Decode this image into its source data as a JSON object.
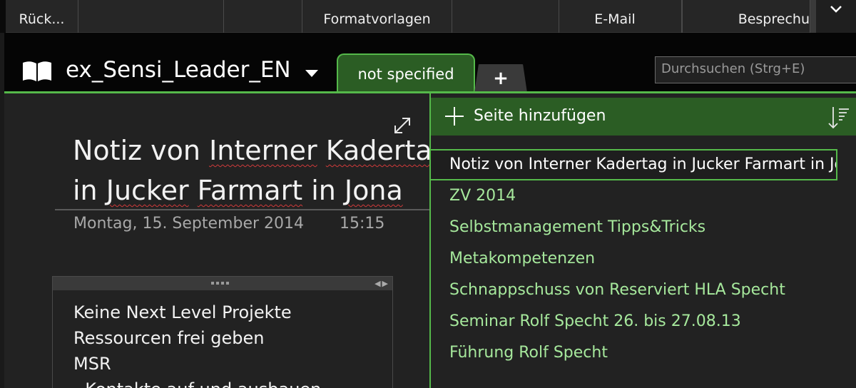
{
  "ribbon": {
    "items": [
      "Rück...",
      "",
      "",
      "Formatvorlagen",
      "",
      "",
      "E-Mail",
      "Besprechu"
    ]
  },
  "notebook": {
    "title": "ex_Sensi_Leader_EN",
    "active_tab": "not specified",
    "add_tab": "+"
  },
  "search": {
    "placeholder": "Durchsuchen (Strg+E)"
  },
  "note": {
    "title_line1_a": "Notiz von ",
    "title_line1_b": "Interner",
    "title_line1_c": " ",
    "title_line1_d": "Kadertag",
    "title_line2_a": "in ",
    "title_line2_b": "Jucker",
    "title_line2_c": " ",
    "title_line2_d": "Farmart",
    "title_line2_e": " in ",
    "title_line2_f": "Jona",
    "date": "Montag, 15. September 2014",
    "time": "15:15",
    "lines": [
      "Keine Next Level Projekte",
      "Ressourcen frei geben",
      "MSR",
      "- Kontakte auf und ausbauen"
    ]
  },
  "pages_panel": {
    "add_label": "Seite hinzufügen",
    "pages": [
      "Notiz von Interner Kadertag in Jucker Farmart in Jona",
      "ZV 2014",
      "Selbstmanagement Tipps&Tricks",
      "Metakompetenzen",
      "Schnappschuss von Reserviert HLA Specht",
      "Seminar Rolf Specht 26. bis 27.08.13",
      "Führung Rolf Specht"
    ]
  },
  "colors": {
    "accent_green": "#55b94a",
    "tab_green": "#2b5d24",
    "page_text": "#a6e89c",
    "squiggle": "#d13a3a"
  }
}
